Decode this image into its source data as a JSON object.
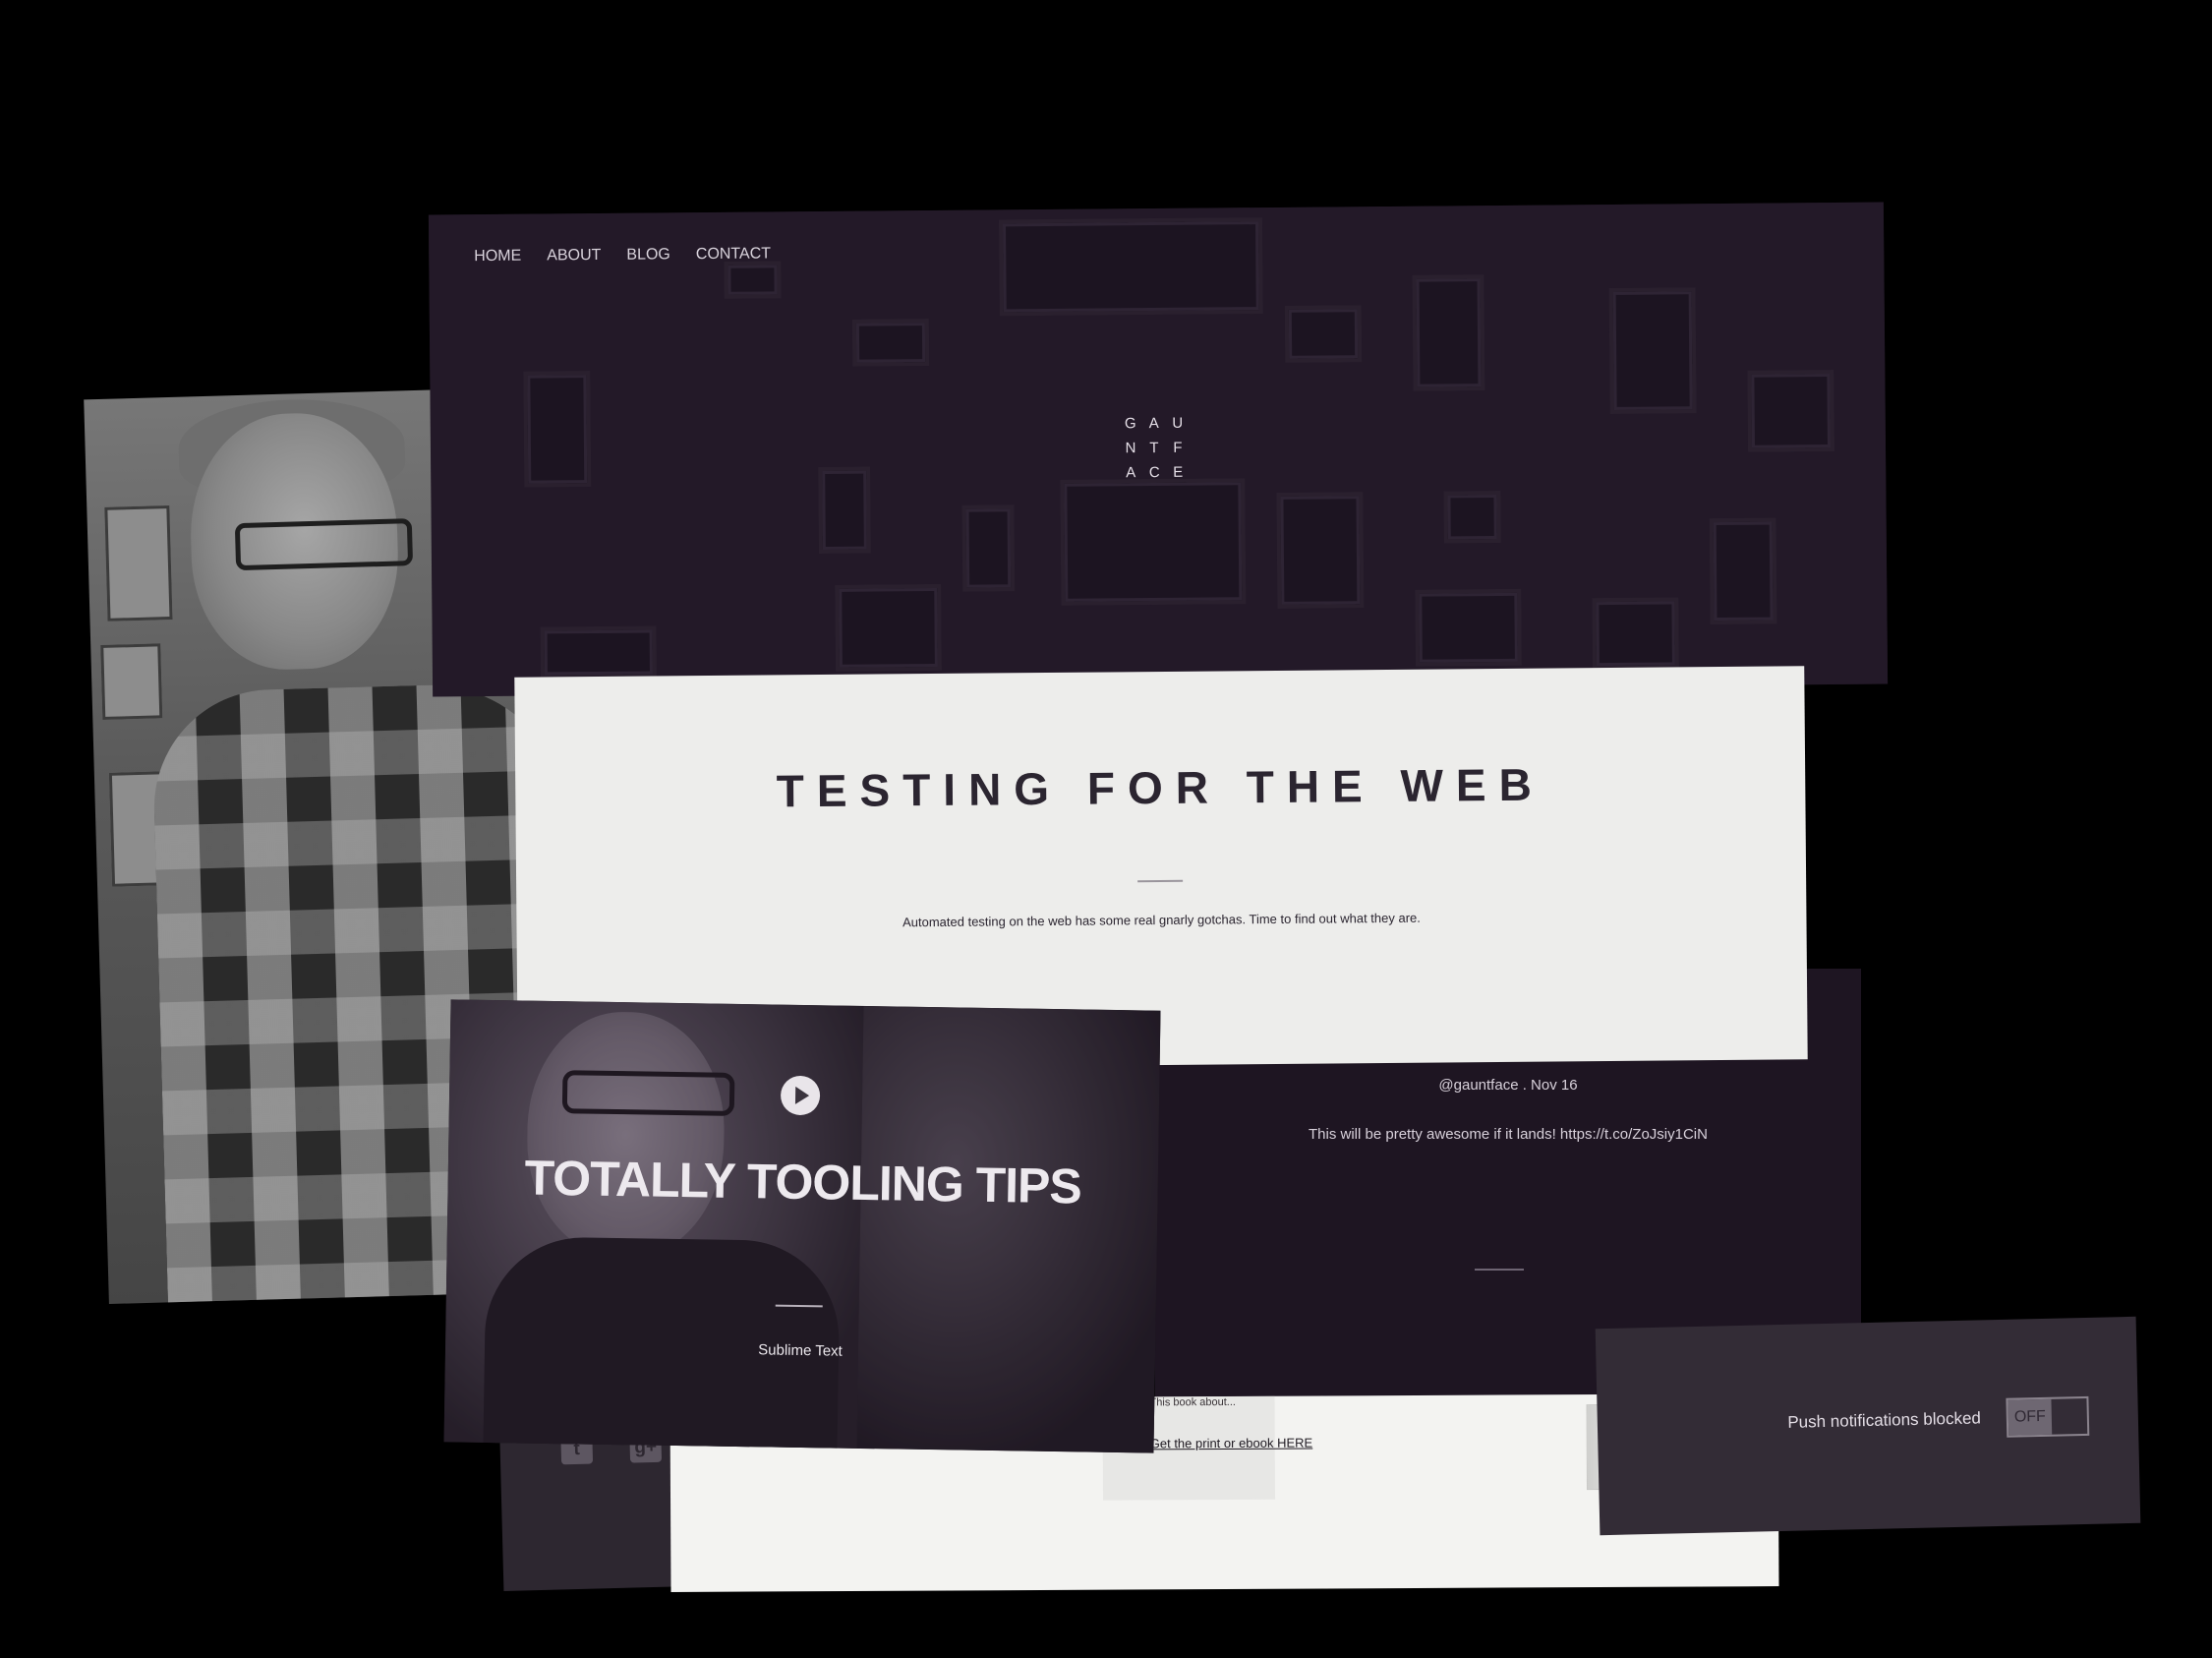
{
  "nav": {
    "items": [
      "HOME",
      "ABOUT",
      "BLOG",
      "CONTACT"
    ]
  },
  "logo": {
    "letters": [
      "G",
      "A",
      "U",
      "N",
      "T",
      "F",
      "A",
      "C",
      "E"
    ]
  },
  "testing": {
    "title": "TESTING FOR THE WEB",
    "description": "Automated testing on the web has some real gnarly gotchas. Time to find out what they are."
  },
  "tweet": {
    "meta": "@gauntface . Nov 16",
    "text": "This will be pretty awesome if it lands! https://t.co/ZoJsiy1CiN"
  },
  "video": {
    "title": "TOTALLY TOOLING TIPS",
    "tag": "Sublime Text"
  },
  "book": {
    "blurb": "This book about...",
    "link": "Get the print or ebook HERE"
  },
  "push": {
    "label": "Push notifications blocked",
    "toggle_state": "OFF"
  },
  "social": {
    "icons": [
      "twitter-icon",
      "google-plus-icon"
    ]
  },
  "colors": {
    "background": "#000000",
    "hero": "#2b1f30",
    "tweet_bg": "#1e1522",
    "paper": "#ededeb"
  }
}
